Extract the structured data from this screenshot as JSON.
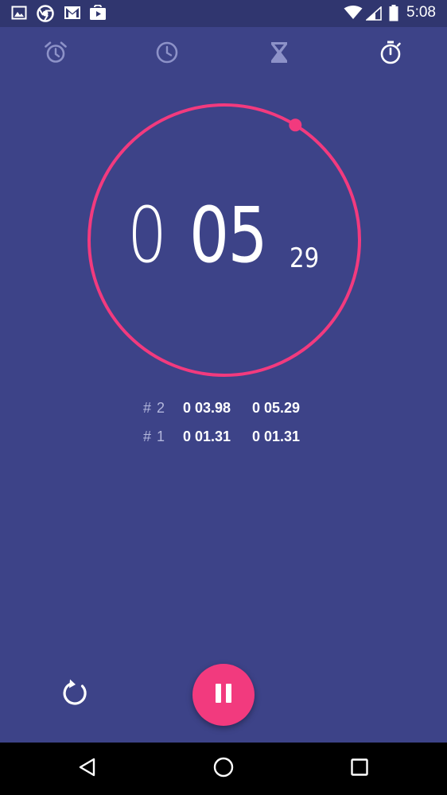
{
  "status_bar": {
    "time": "5:08",
    "notification_icons": [
      "image-icon",
      "chrome-icon",
      "gmail-icon",
      "play-store-icon"
    ],
    "system_icons": [
      "wifi-icon",
      "signal-icon",
      "battery-icon"
    ]
  },
  "tabs": [
    {
      "name": "alarm",
      "icon": "alarm-icon",
      "active": false
    },
    {
      "name": "clock",
      "icon": "clock-icon",
      "active": false
    },
    {
      "name": "timer",
      "icon": "hourglass-icon",
      "active": false
    },
    {
      "name": "stopwatch",
      "icon": "stopwatch-icon",
      "active": true
    }
  ],
  "stopwatch": {
    "minutes": "0",
    "seconds": "05",
    "hundredths": "29",
    "dial_progress": 0.088
  },
  "laps": [
    {
      "label": "# 2",
      "lap_time": "0 03.98",
      "total_time": "0 05.29"
    },
    {
      "label": "# 1",
      "lap_time": "0 01.31",
      "total_time": "0 01.31"
    }
  ],
  "controls": {
    "reset_icon": "reset-icon",
    "primary_icon": "pause-icon"
  },
  "colors": {
    "background": "#3d4388",
    "status_bar": "#30366f",
    "accent": "#f23a7e",
    "tab_inactive": "#8d92c8",
    "tab_active": "#ffffff"
  },
  "nav_bar": {
    "icons": [
      "back-icon",
      "home-icon",
      "recents-icon"
    ]
  }
}
